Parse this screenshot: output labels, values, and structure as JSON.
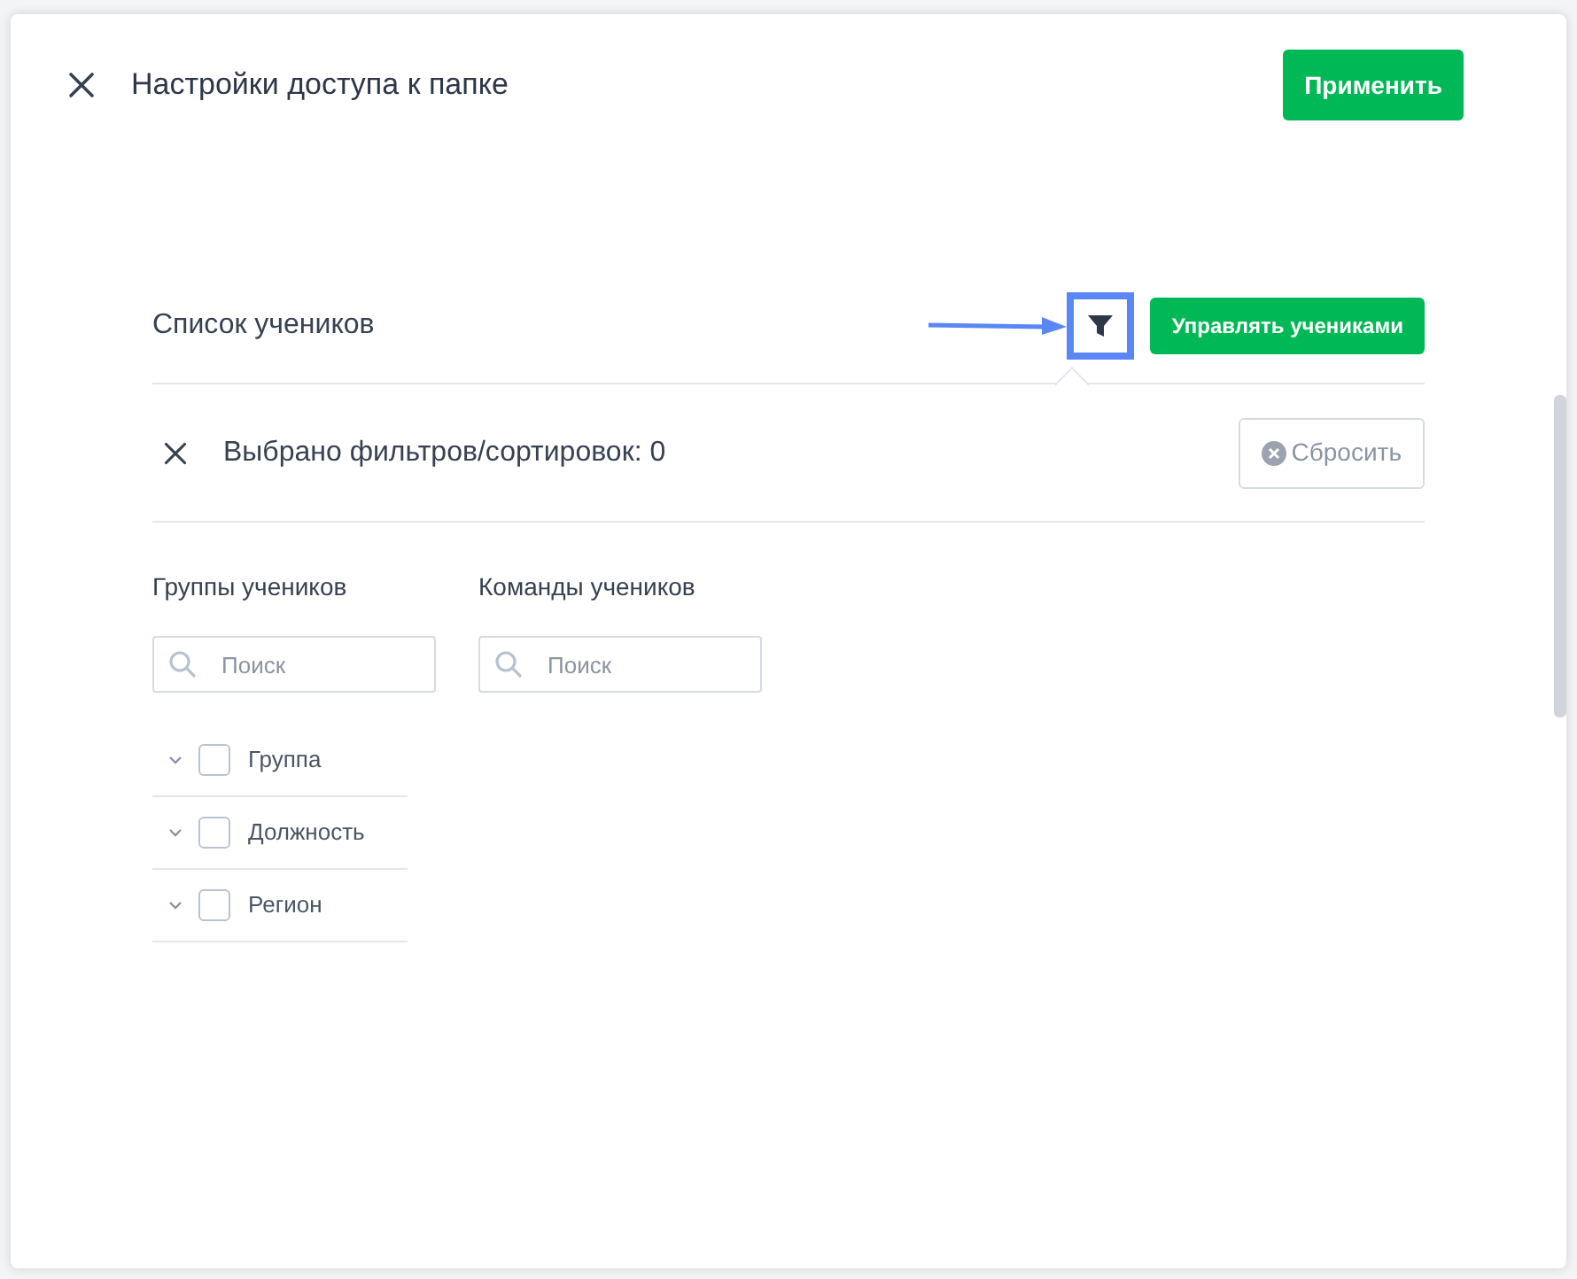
{
  "dialog": {
    "title": "Настройки доступа к папке",
    "apply_button": "Применить"
  },
  "students": {
    "title": "Список учеников",
    "manage_button": "Управлять учениками",
    "filter_highlighted": true
  },
  "filter_panel": {
    "summary": "Выбрано фильтров/сортировок: 0",
    "reset_button": "Сбросить",
    "columns": [
      {
        "title": "Группы учеников",
        "search": {
          "placeholder": "Поиск"
        },
        "items": [
          {
            "label": "Группа",
            "checked": false,
            "expanded": false
          },
          {
            "label": "Должность",
            "checked": false,
            "expanded": false
          },
          {
            "label": "Регион",
            "checked": false,
            "expanded": false
          }
        ]
      },
      {
        "title": "Команды учеников",
        "search": {
          "placeholder": "Поиск"
        }
      }
    ]
  }
}
